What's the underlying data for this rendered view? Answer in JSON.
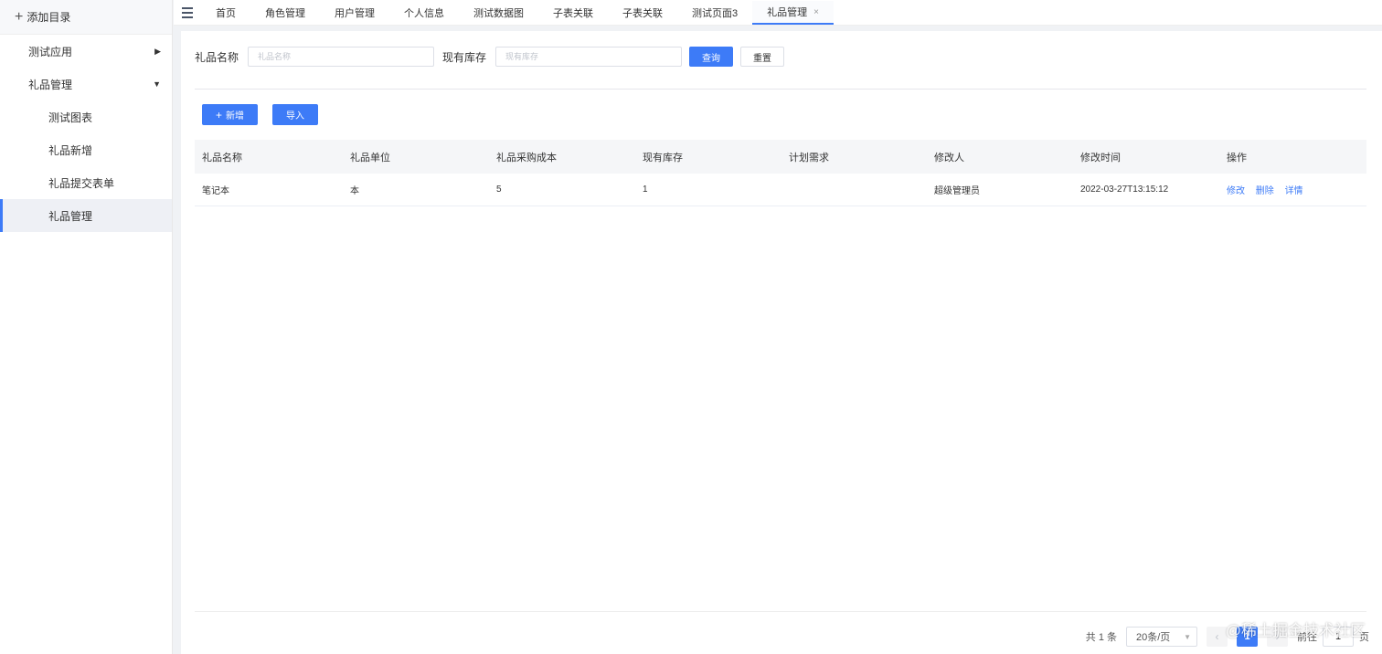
{
  "sidebar": {
    "add_dir": "添加目录",
    "items": [
      {
        "label": "测试应用",
        "arrow": "▶"
      },
      {
        "label": "礼品管理",
        "arrow": "▼"
      }
    ],
    "sub_items": [
      "测试图表",
      "礼品新增",
      "礼品提交表单",
      "礼品管理"
    ]
  },
  "tabs": [
    "首页",
    "角色管理",
    "用户管理",
    "个人信息",
    "测试数据图",
    "子表关联",
    "子表关联",
    "测试页面3",
    "礼品管理"
  ],
  "tab_close": "×",
  "search": {
    "name_label": "礼品名称",
    "name_placeholder": "礼品名称",
    "stock_label": "现有库存",
    "stock_placeholder": "现有库存",
    "query_btn": "查询",
    "reset_btn": "重置"
  },
  "actions": {
    "add": "新增",
    "import": "导入"
  },
  "table": {
    "headers": [
      "礼品名称",
      "礼品单位",
      "礼品采购成本",
      "现有库存",
      "计划需求",
      "修改人",
      "修改时间",
      "操作"
    ],
    "rows": [
      {
        "name": "笔记本",
        "unit": "本",
        "cost": "5",
        "stock": "1",
        "plan": "",
        "modifier": "超级管理员",
        "time": "2022-03-27T13:15:12"
      }
    ],
    "ops": [
      "修改",
      "删除",
      "详情"
    ]
  },
  "pagination": {
    "total": "共 1 条",
    "page_size": "20条/页",
    "prev": "‹",
    "current": "1",
    "next": "›",
    "goto_prefix": "前往",
    "goto_value": "1",
    "goto_suffix": "页"
  },
  "watermark": "@稀土掘金技术社区",
  "colors": {
    "primary": "#3d7bf7",
    "sidebar_active_bg": "#eef0f5"
  }
}
